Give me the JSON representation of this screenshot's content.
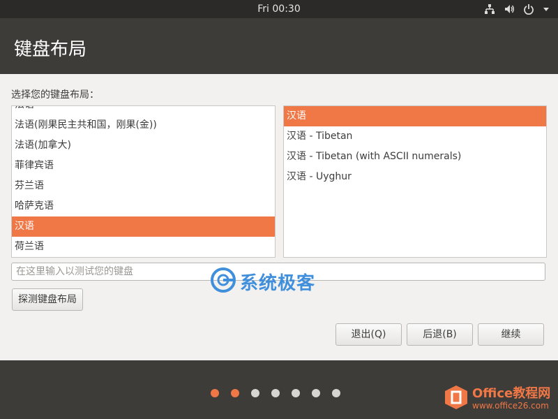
{
  "top_panel": {
    "clock": "Fri 00:30",
    "icons": [
      "network-icon",
      "volume-icon",
      "power-icon",
      "menu-arrow-icon"
    ]
  },
  "header": {
    "title": "键盘布局"
  },
  "main": {
    "prompt": "选择您的键盘布局：",
    "layouts": [
      {
        "label": "法语"
      },
      {
        "label": "法语(刚果民主共和国，刚果(金))"
      },
      {
        "label": "法语(加拿大)"
      },
      {
        "label": "菲律宾语"
      },
      {
        "label": "芬兰语"
      },
      {
        "label": "哈萨克语"
      },
      {
        "label": "汉语",
        "selected": true
      },
      {
        "label": "荷兰语"
      }
    ],
    "variants": [
      {
        "label": "汉语",
        "selected": true
      },
      {
        "label": "汉语 - Tibetan"
      },
      {
        "label": "汉语 - Tibetan (with ASCII numerals)"
      },
      {
        "label": "汉语 - Uyghur"
      }
    ],
    "test_input": {
      "placeholder": "在这里输入以测试您的键盘",
      "value": ""
    },
    "detect_button": "探测键盘布局",
    "buttons": {
      "quit": "退出(Q)",
      "back": "后退(B)",
      "continue": "继续"
    }
  },
  "watermark": {
    "text": "系统极客"
  },
  "footer": {
    "steps_total": 7,
    "steps_done": 2,
    "logo": {
      "title": "Office教程网",
      "url": "www.office26.com"
    }
  },
  "colors": {
    "accent": "#f07746",
    "panel": "#2b2a28",
    "band": "#3e3c39",
    "background": "#f2f1f0"
  }
}
